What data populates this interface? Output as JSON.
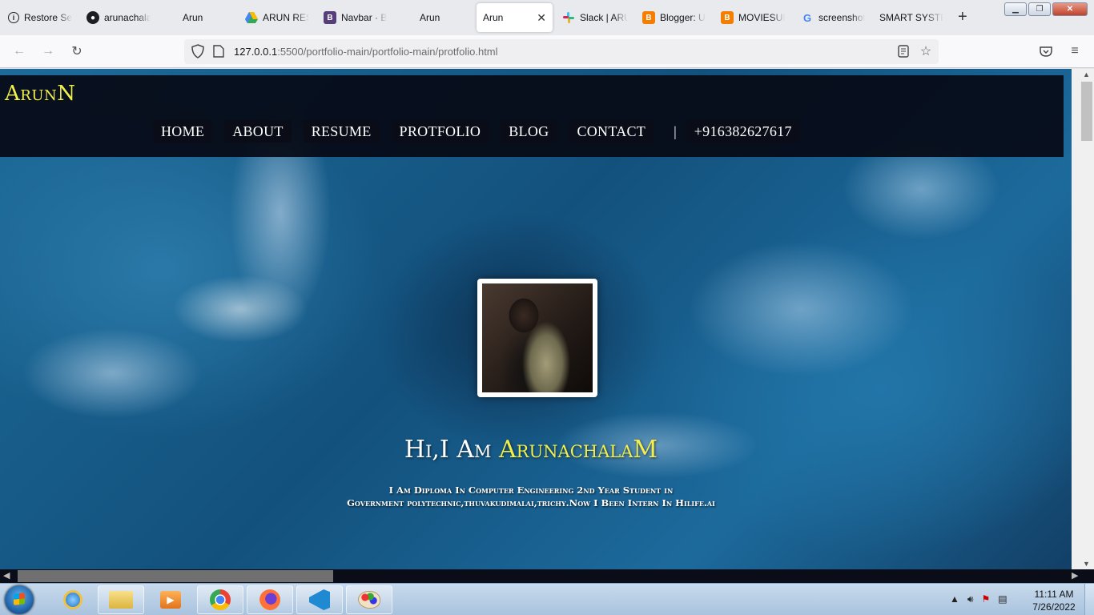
{
  "browser": {
    "tabs": [
      {
        "title": "Restore Se",
        "icon": "info-icon"
      },
      {
        "title": "arunachala",
        "icon": "github-icon"
      },
      {
        "title": "Arun",
        "icon": "blank-page-icon"
      },
      {
        "title": "ARUN RES",
        "icon": "google-drive-icon"
      },
      {
        "title": "Navbar · B",
        "icon": "bootstrap-icon"
      },
      {
        "title": "Arun",
        "icon": "blank-page-icon"
      },
      {
        "title": "Arun",
        "icon": "blank-page-icon"
      },
      {
        "title": "Slack | ARU",
        "icon": "slack-icon"
      },
      {
        "title": "Blogger: U",
        "icon": "blogger-icon"
      },
      {
        "title": "MOVIESUB",
        "icon": "blogger-icon"
      },
      {
        "title": "screenshot",
        "icon": "google-icon"
      },
      {
        "title": "SMART SYSTE",
        "icon": "blank-page-icon"
      }
    ],
    "active_tab_index": 6,
    "close_glyph": "✕",
    "new_tab_glyph": "+",
    "url_host": "127.0.0.1",
    "url_rest": ":5500/portfolio-main/portfolio-main/protfolio.html",
    "colors": {
      "accent": "#0060df"
    }
  },
  "site": {
    "brand": "ArunN",
    "menu": [
      "HOME",
      "ABOUT",
      "RESUME",
      "PROTFOLIO",
      "BLOG",
      "CONTACT"
    ],
    "separator": "|",
    "phone": "+916382627617",
    "hero_greeting": "Hi,I Am ",
    "hero_name": "ArunachalaM",
    "hero_sub_line1": "I Am Diploma In Computer Engineering 2nd Year Student in",
    "hero_sub_line2": "Government polytechnic,thuvakudimalai,trichy.Now I Been Intern In Hilife.ai",
    "colors": {
      "header_bg": "#060a16",
      "brand": "#f2ee4b",
      "highlight": "#f2ee4b"
    }
  },
  "taskbar": {
    "apps": [
      {
        "name": "internet-explorer-icon",
        "pinned": false
      },
      {
        "name": "file-explorer-icon",
        "pinned": true
      },
      {
        "name": "media-player-icon",
        "pinned": false
      },
      {
        "name": "chrome-icon",
        "pinned": true
      },
      {
        "name": "firefox-icon",
        "pinned": true
      },
      {
        "name": "vscode-icon",
        "pinned": true
      },
      {
        "name": "paint-icon",
        "pinned": true
      }
    ],
    "time": "11:11 AM",
    "date": "7/26/2022"
  }
}
